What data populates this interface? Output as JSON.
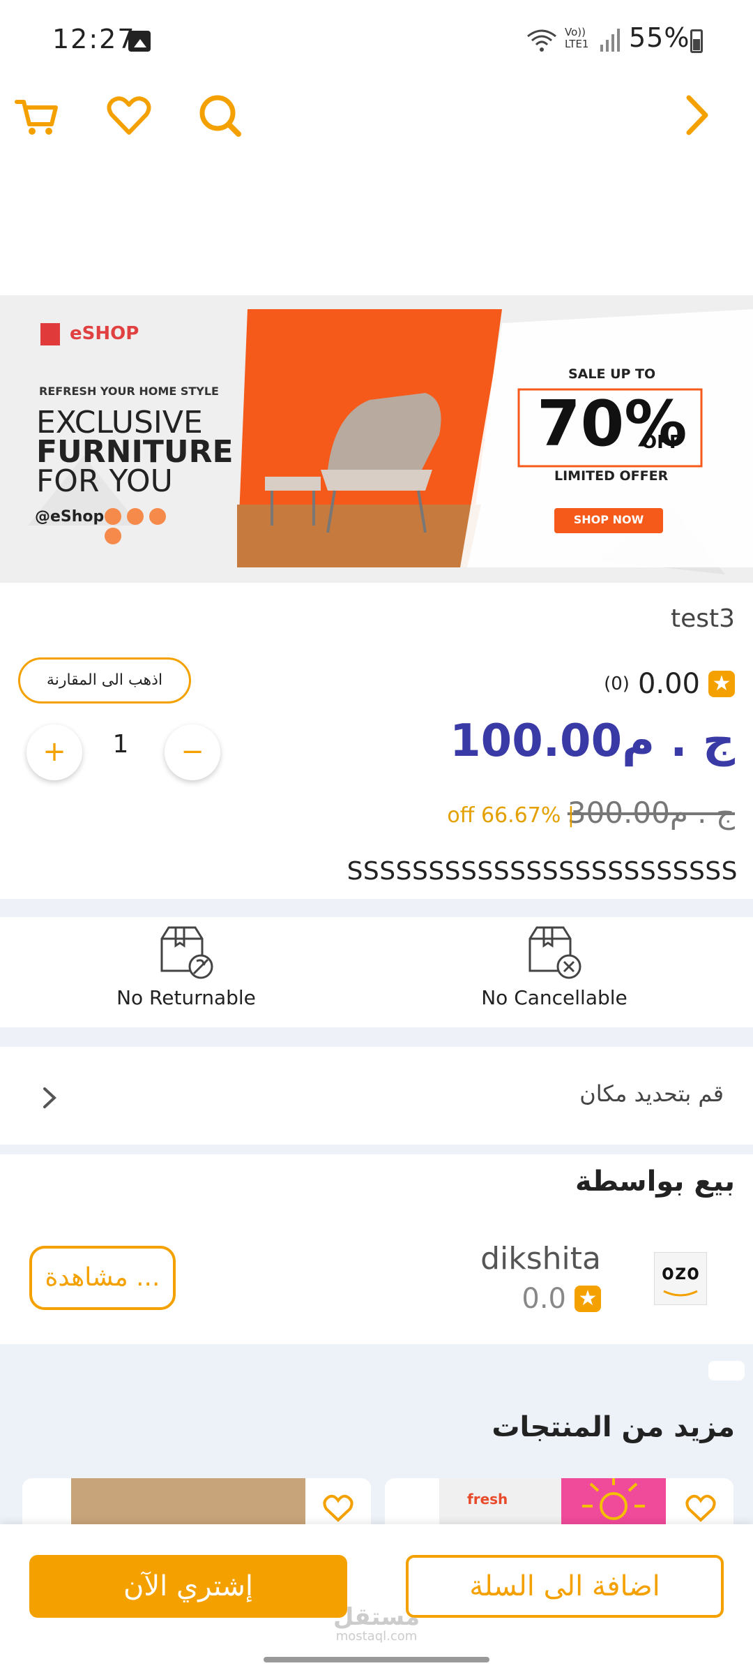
{
  "status_bar": {
    "time": "12:27",
    "network": "Vo)) LTE1",
    "battery": "55%"
  },
  "top_bar": {
    "icons": [
      "cart-icon",
      "heart-icon",
      "search-icon",
      "back-chevron-icon"
    ],
    "accent_color": "#f4a100"
  },
  "banner": {
    "brand": "eSHOP",
    "tagline": "REFRESH YOUR HOME STYLE",
    "headline_1": "EXCLUSIVE",
    "headline_2": "FURNITURE",
    "headline_3": "FOR YOU",
    "handle": "@eShop",
    "sale_text": "SALE UP TO",
    "sale_percent": "70%",
    "sale_off": "OFF",
    "limited": "LIMITED OFFER",
    "shop_now": "SHOP NOW"
  },
  "product": {
    "title": "test3",
    "rating": "0.00",
    "rating_count": "(0)",
    "price": "ج . م100.00",
    "old_price": "ج . م300.00",
    "discount": "off 66.67%  |",
    "description": "SSSSSSSSSSSSSSSSSSSSSSSS",
    "quantity": "1",
    "compare_label": "اذهب الى المقارنة",
    "price_color": "#3a3aa6"
  },
  "policies": [
    {
      "label": "No Returnable",
      "icon": "no-return-box-icon"
    },
    {
      "label": "No Cancellable",
      "icon": "no-cancel-box-icon"
    }
  ],
  "location": {
    "label": "قم بتحديد مكان"
  },
  "seller": {
    "section_title": "بيع بواسطة",
    "logo_text": "ozo",
    "name": "dikshita",
    "rating": "0.0",
    "view_label": "مشاهدة ..."
  },
  "more_products": {
    "title": "مزيد من المنتجات",
    "card_logo_text": "fresh"
  },
  "bottom_bar": {
    "buy_now": "إشتري الآن",
    "add_to_cart": "اضافة الى السلة"
  },
  "watermark": {
    "text": "مستقل",
    "sub": "mostaql.com"
  }
}
